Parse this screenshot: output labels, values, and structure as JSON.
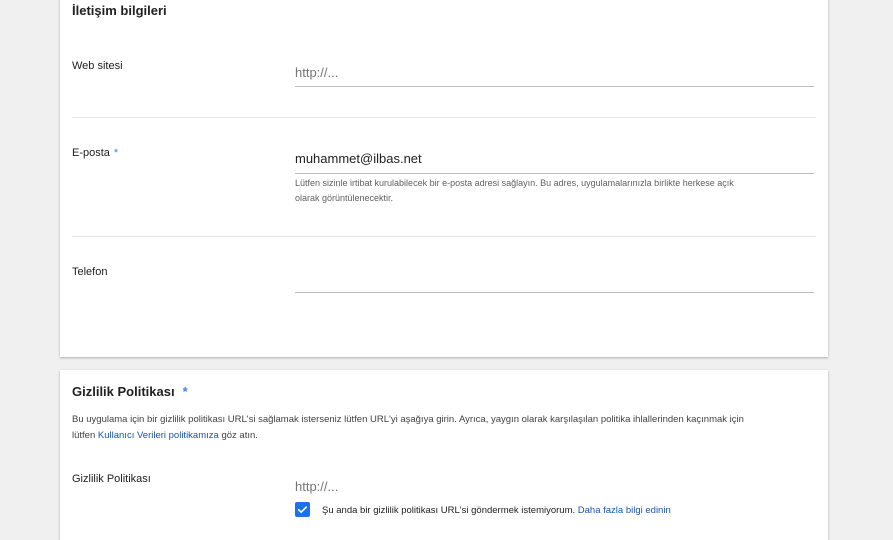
{
  "contact": {
    "title": "İletişim bilgileri",
    "website": {
      "label": "Web sitesi",
      "placeholder": "http://..."
    },
    "email": {
      "label": "E-posta",
      "required_mark": "*",
      "value": "muhammet@ilbas.net",
      "help_line1": "Lütfen sizinle irtibat kurulabilecek bir e-posta adresi sağlayın. Bu adres, uygulamalarınızla birlikte herkese açık",
      "help_line2": "olarak görüntülenecektir."
    },
    "phone": {
      "label": "Telefon"
    }
  },
  "privacy": {
    "title": "Gizlilik Politikası",
    "required_mark": "*",
    "desc_line1": "Bu uygulama için bir gizlilik politikası URL'si sağlamak isterseniz lütfen URL'yi aşağıya girin. Ayrıca, yaygın olarak karşılaşılan politika ihlallerinden kaçınmak için",
    "desc_line2_prefix": "lütfen ",
    "desc_link": "Kullanıcı Verileri politikamıza",
    "desc_line2_suffix": " göz atın.",
    "field_label": "Gizlilik Politikası",
    "placeholder": "http://...",
    "checkbox_checked": true,
    "checkbox_label": "Şu anda bir gizlilik politikası URL'si göndermek istemiyorum.",
    "learn_more": "Daha fazla bilgi edinin"
  },
  "colors": {
    "accent": "#1a73e8",
    "link": "#1a55a6",
    "background": "#f0f0f0"
  }
}
